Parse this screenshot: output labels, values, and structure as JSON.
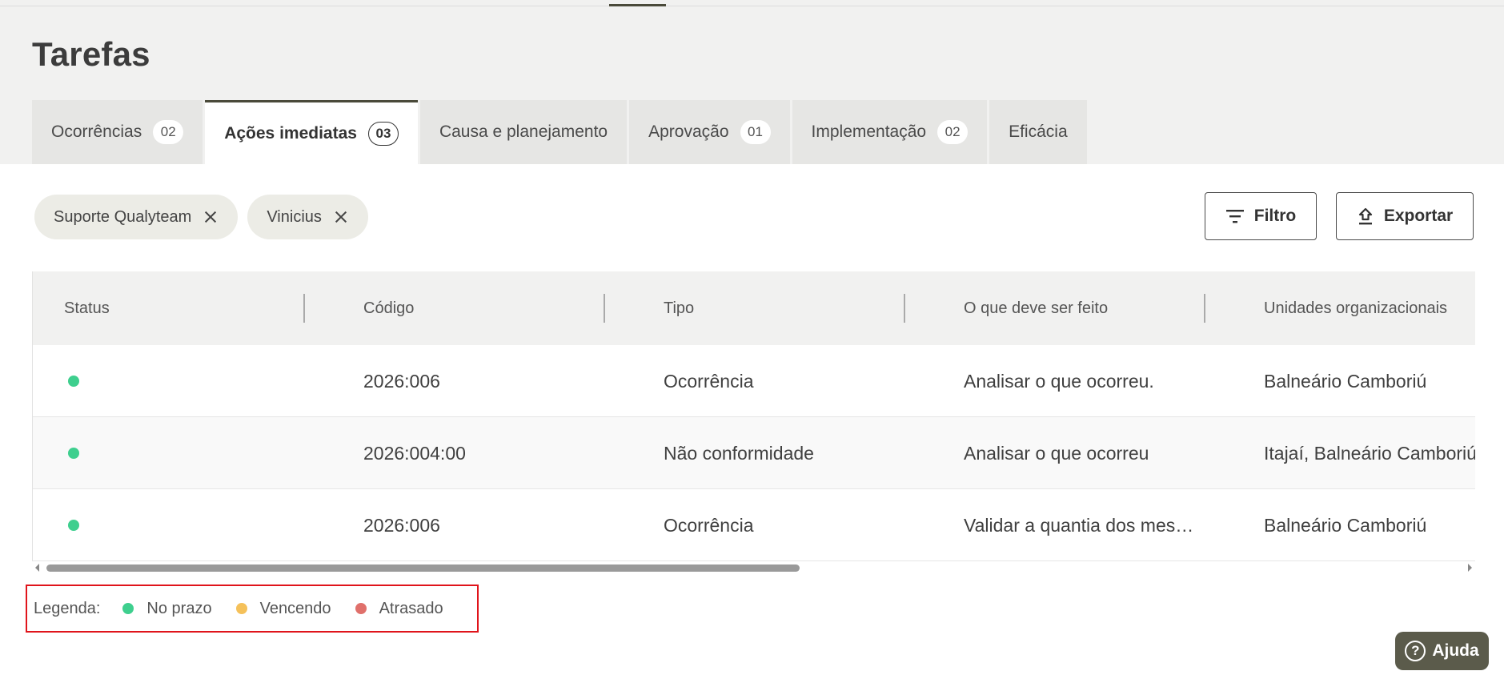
{
  "page": {
    "title": "Tarefas"
  },
  "tabs": [
    {
      "label": "Ocorrências",
      "badge": "02",
      "active": false
    },
    {
      "label": "Ações imediatas",
      "badge": "03",
      "active": true
    },
    {
      "label": "Causa e planejamento",
      "badge": "",
      "active": false
    },
    {
      "label": "Aprovação",
      "badge": "01",
      "active": false
    },
    {
      "label": "Implementação",
      "badge": "02",
      "active": false
    },
    {
      "label": "Eficácia",
      "badge": "",
      "active": false
    }
  ],
  "filters": [
    {
      "label": "Suporte Qualyteam"
    },
    {
      "label": "Vinicius"
    }
  ],
  "toolbar": {
    "filter_label": "Filtro",
    "export_label": "Exportar"
  },
  "table": {
    "columns": [
      "Status",
      "Código",
      "Tipo",
      "O que deve ser feito",
      "Unidades organizacionais"
    ],
    "rows": [
      {
        "status": "No prazo",
        "codigo": "2026:006",
        "tipo": "Ocorrência",
        "acao": "Analisar o que ocorreu.",
        "unidades": "Balneário Camboriú"
      },
      {
        "status": "No prazo",
        "codigo": "2026:004:00",
        "tipo": "Não conformidade",
        "acao": "Analisar o que ocorreu",
        "unidades": "Itajaí, Balneário Camboriú"
      },
      {
        "status": "No prazo",
        "codigo": "2026:006",
        "tipo": "Ocorrência",
        "acao": "Validar a quantia dos mes…",
        "unidades": "Balneário Camboriú"
      }
    ]
  },
  "legend": {
    "label": "Legenda:",
    "items": [
      {
        "label": "No prazo",
        "color": "#3ecf8e"
      },
      {
        "label": "Vencendo",
        "color": "#f5c15a"
      },
      {
        "label": "Atrasado",
        "color": "#e0706b"
      }
    ]
  },
  "colors": {
    "on_time": "#3ecf8e",
    "accent_dark": "#4a4a3a",
    "help_bg": "#5b5b4b"
  },
  "help": {
    "label": "Ajuda",
    "icon": "question-circle-icon"
  }
}
